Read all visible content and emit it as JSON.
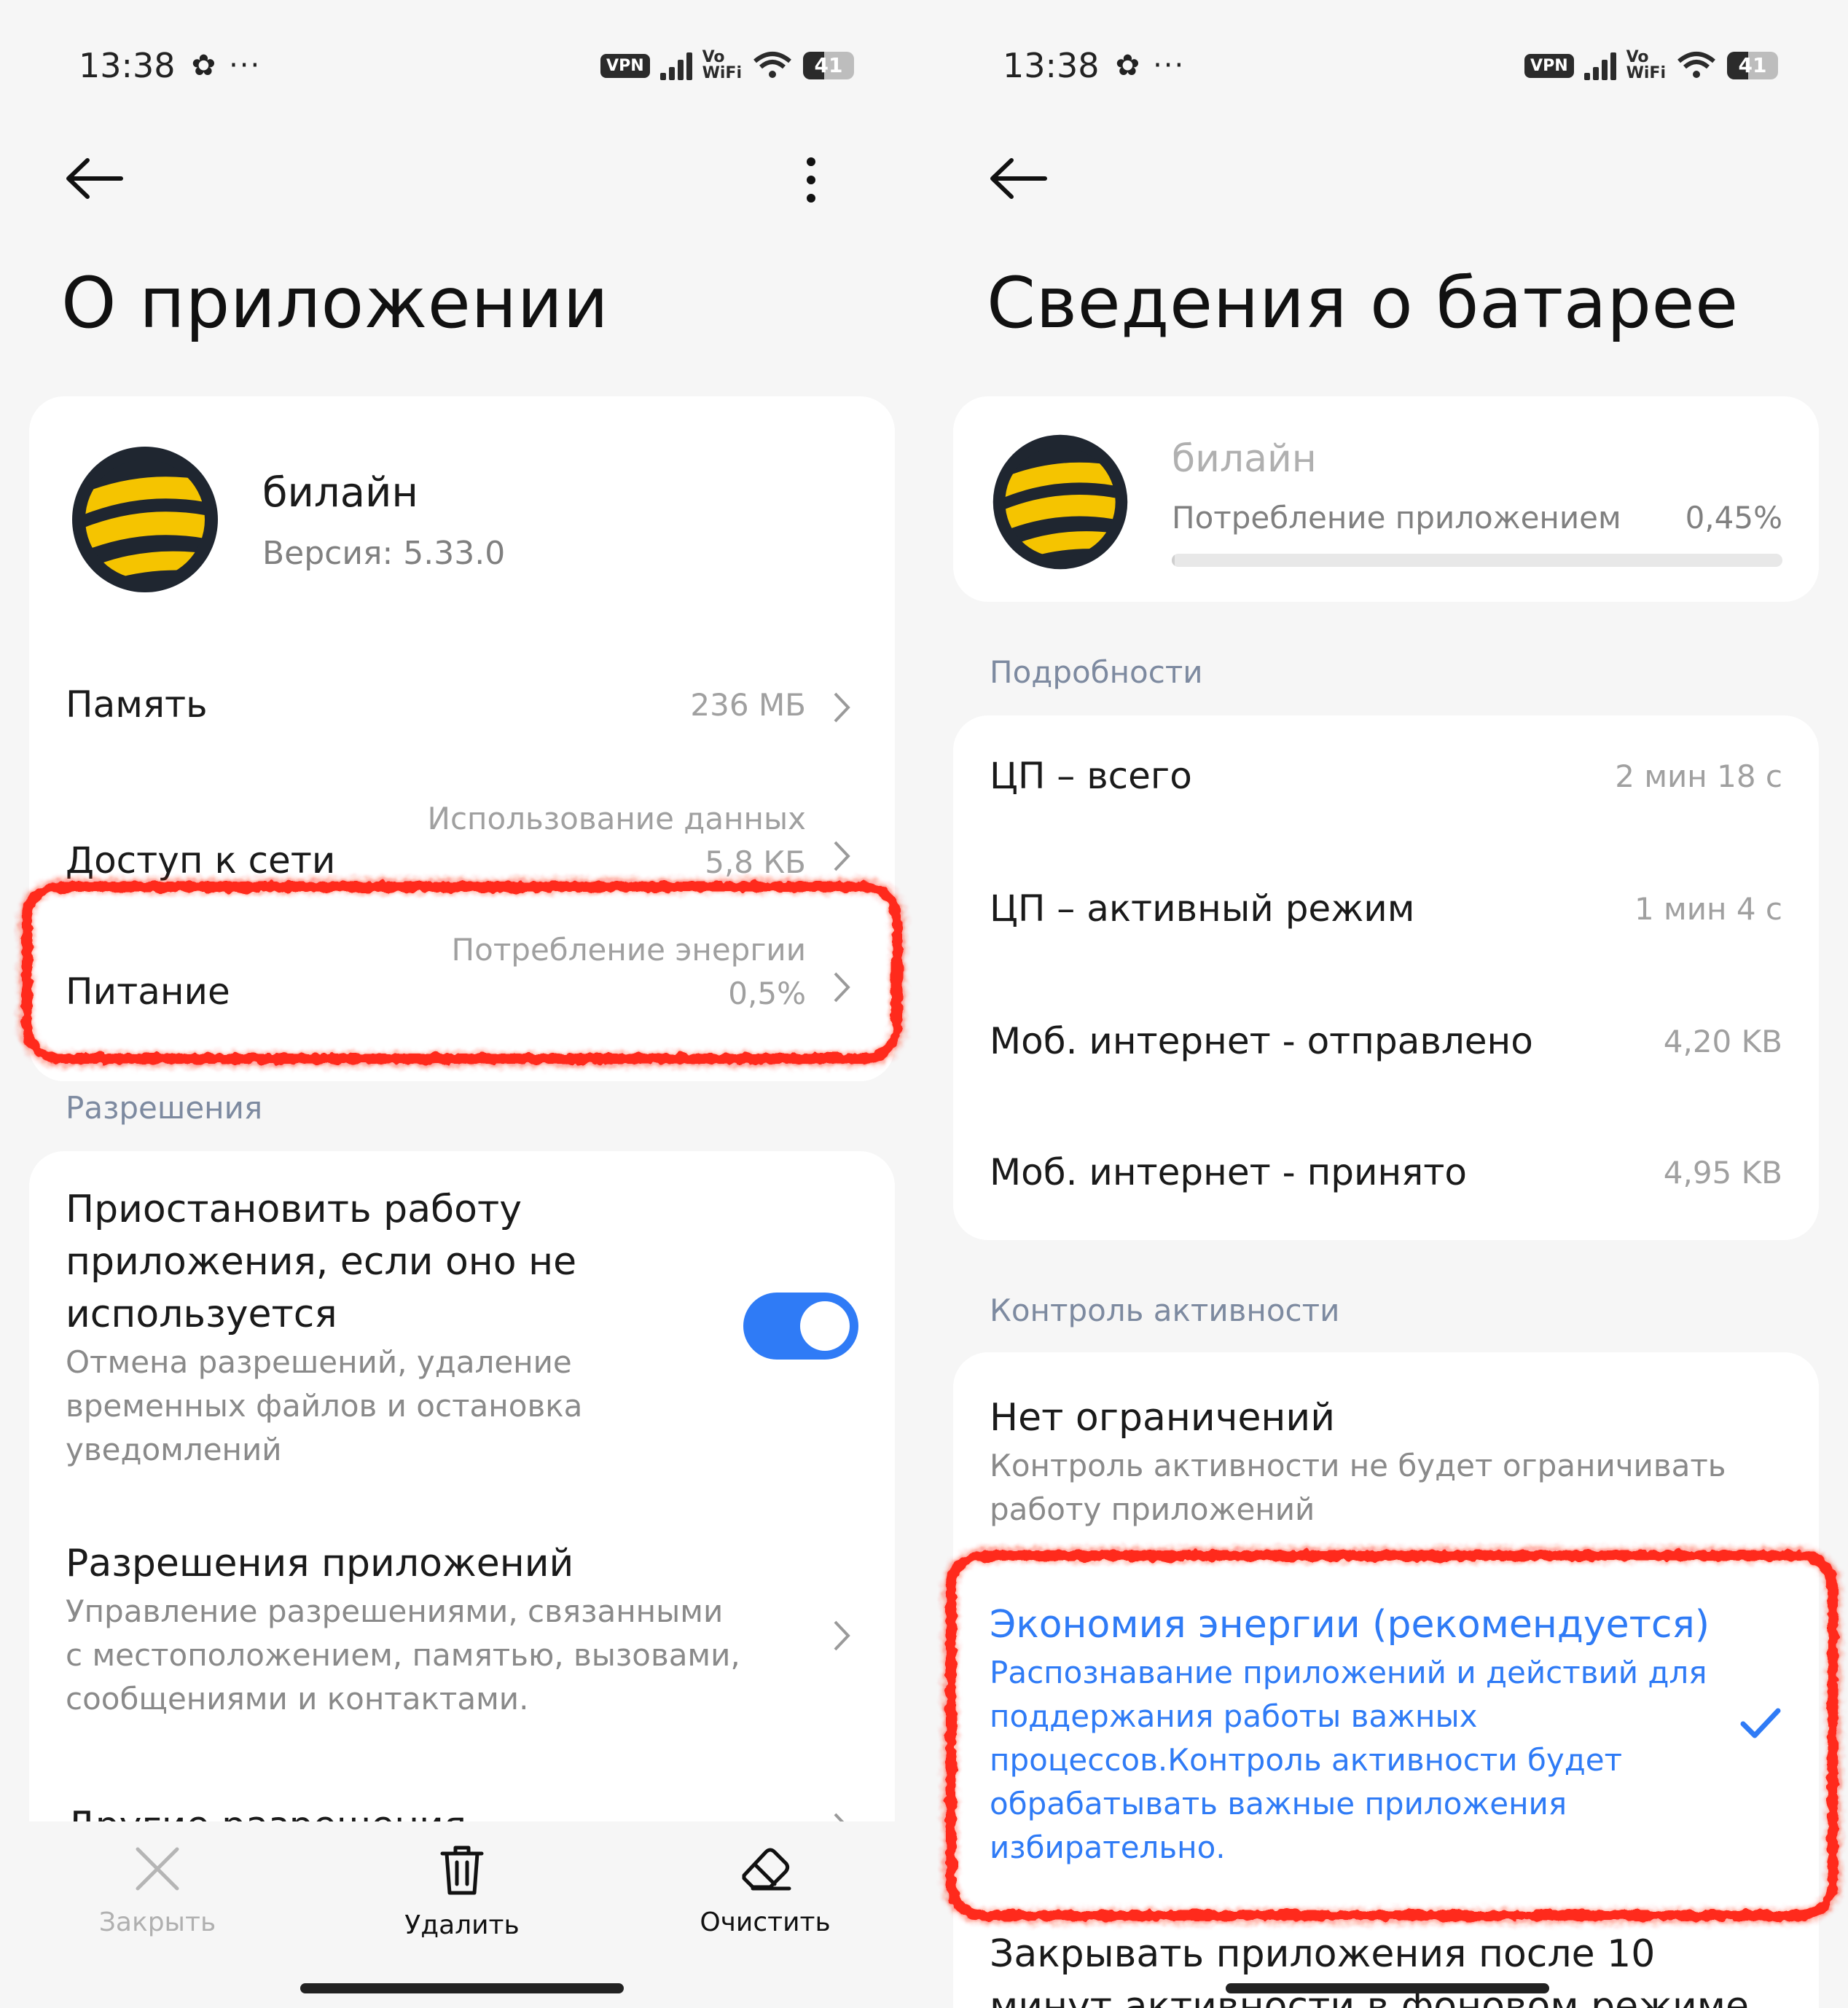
{
  "left": {
    "status": {
      "time": "13:38",
      "vpn": "VPN",
      "vowifi_top": "Vo",
      "vowifi_bottom": "WiFi",
      "battery": "41"
    },
    "title": "О приложении",
    "app": {
      "name": "билайн",
      "version": "Версия: 5.33.0"
    },
    "rows": [
      {
        "label": "Память",
        "value": "236 МБ"
      },
      {
        "label": "Доступ к сети",
        "value_line1": "Использование данных",
        "value_line2": "5,8 КБ"
      },
      {
        "label": "Питание",
        "value_line1": "Потребление энергии",
        "value_line2": "0,5%"
      }
    ],
    "permissions_header": "Разрешения",
    "pause": {
      "title_lines": [
        "Приостановить работу",
        "приложения, если оно не",
        "используется"
      ],
      "desc_lines": [
        "Отмена разрешений, удаление",
        "временных файлов и остановка",
        "уведомлений"
      ],
      "enabled": true
    },
    "app_perms": {
      "title": "Разрешения приложений",
      "desc_lines": [
        "Управление разрешениями, связанными",
        "с местоположением, памятью, вызовами,",
        "сообщениями и контактами."
      ]
    },
    "other_perms": "Другие разрешения",
    "bottom": {
      "close": "Закрыть",
      "delete": "Удалить",
      "clear": "Очистить"
    }
  },
  "right": {
    "status": {
      "time": "13:38",
      "vpn": "VPN",
      "vowifi_top": "Vo",
      "vowifi_bottom": "WiFi",
      "battery": "41"
    },
    "title": "Сведения о батарее",
    "app": {
      "name": "билайн",
      "usage_label": "Потребление приложением",
      "usage_value": "0,45%",
      "usage_fraction": 0.0045
    },
    "details_header": "Подробности",
    "details": [
      {
        "label": "ЦП – всего",
        "value": "2 мин 18 с"
      },
      {
        "label": "ЦП – активный режим",
        "value": "1 мин 4 с"
      },
      {
        "label": "Моб. интернет - отправлено",
        "value": "4,20 KB"
      },
      {
        "label": "Моб. интернет - принято",
        "value": "4,95 KB"
      }
    ],
    "activity_header": "Контроль активности",
    "options": {
      "no_limits": {
        "title": "Нет ограничений",
        "desc_lines": [
          "Контроль активности не будет ограничивать",
          "работу приложений"
        ]
      },
      "saver": {
        "title": "Экономия энергии (рекомендуется)",
        "desc_lines": [
          "Распознавание приложений и действий для",
          "поддержания работы важных",
          "процессов.Контроль активности будет",
          "обрабатывать важные приложения",
          "избирательно."
        ],
        "selected": true
      },
      "close_after_lines": [
        "Закрывать приложения после 10",
        "минут активности в фоновом режиме"
      ]
    }
  },
  "colors": {
    "accent": "#2f7bf6",
    "highlight": "#ff2a1a",
    "logo_yellow": "#f5c400",
    "logo_dark": "#1f2630"
  }
}
